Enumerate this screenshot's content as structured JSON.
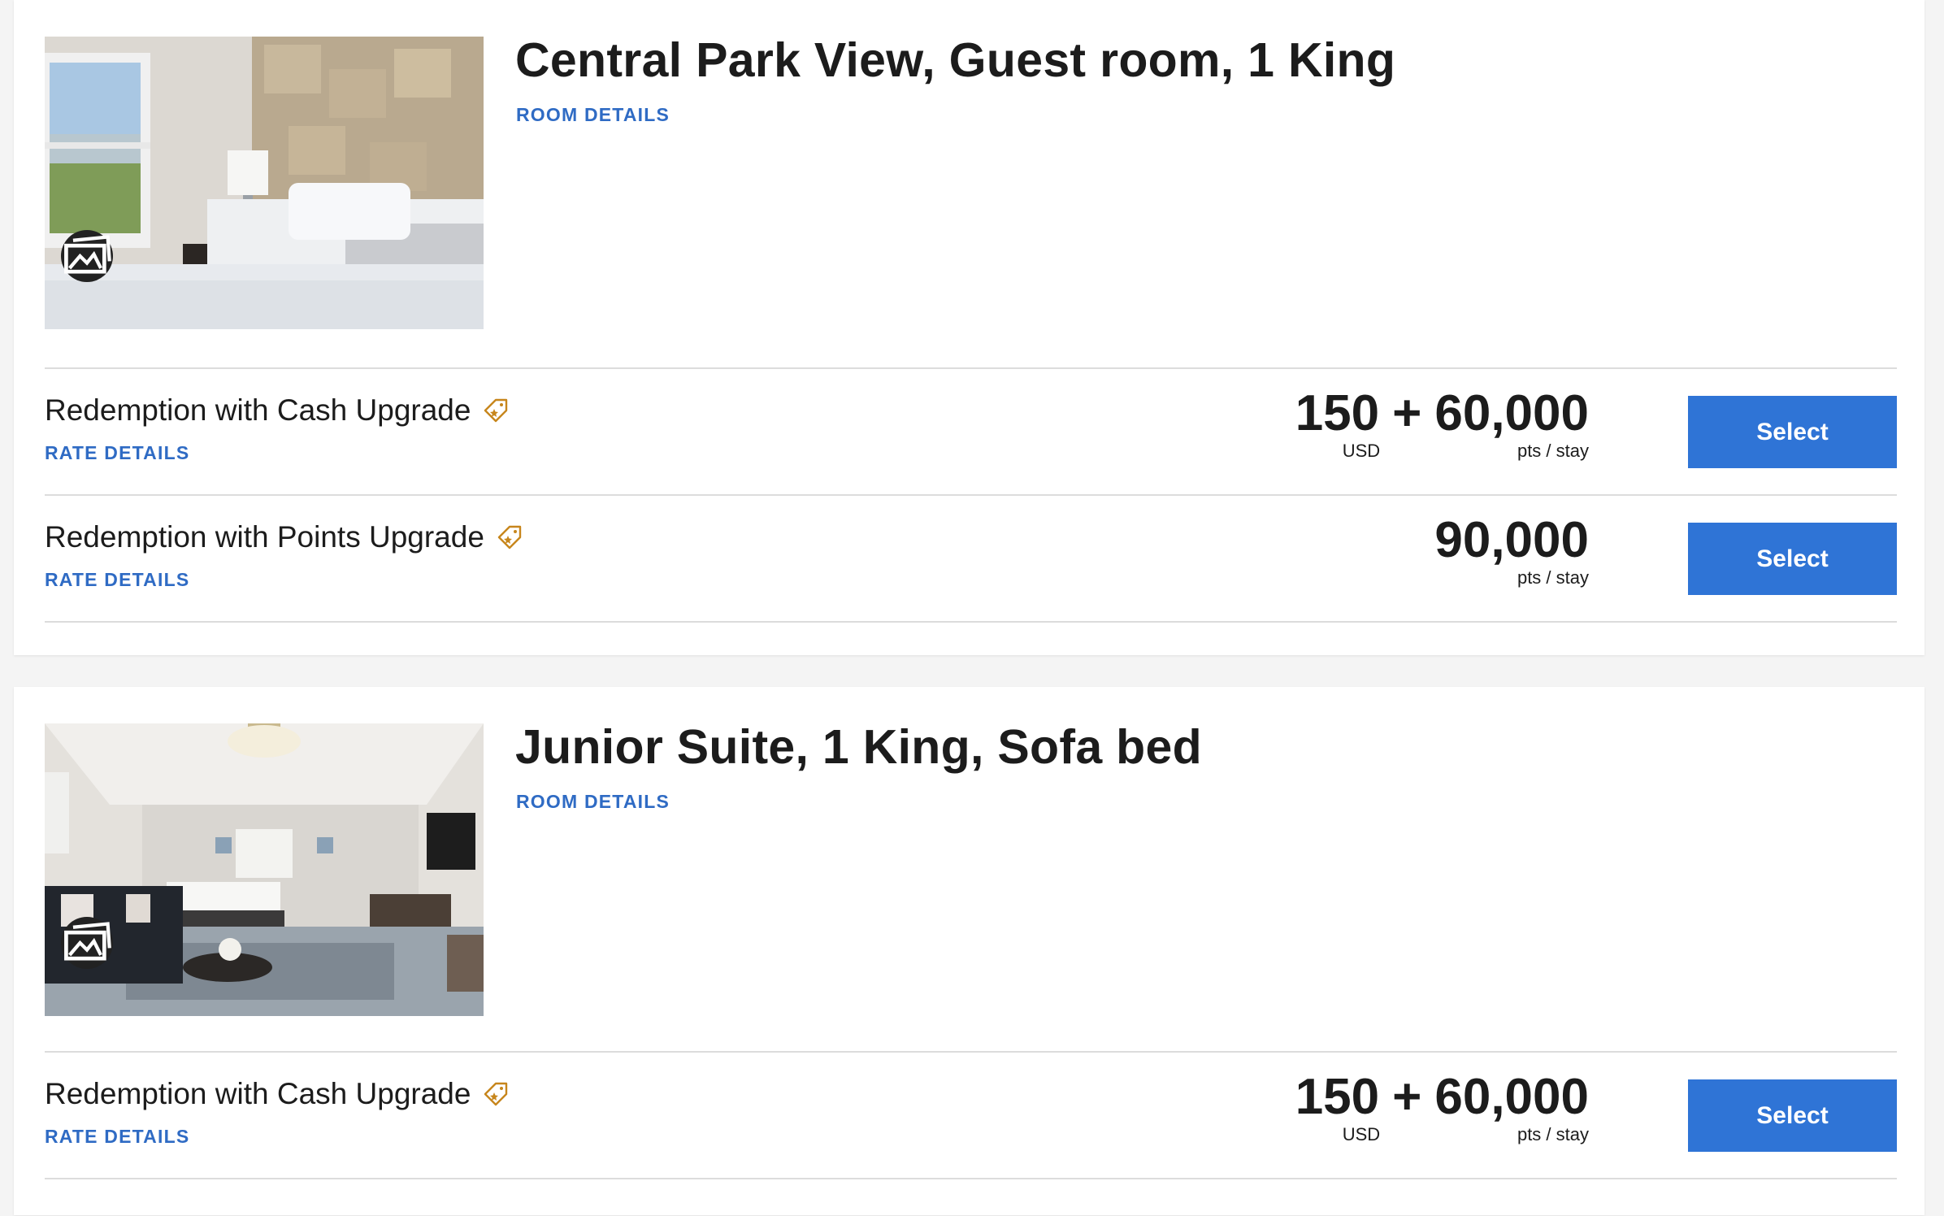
{
  "colors": {
    "link": "#2f6bc4",
    "button": "#2f74d6",
    "tag_icon": "#c7861c",
    "divider": "#dcdcdc"
  },
  "rooms": [
    {
      "title": "Central Park View, Guest room, 1 King",
      "details_link": "ROOM DETAILS",
      "gallery_icon": "photo-gallery-icon",
      "rates": [
        {
          "name": "Redemption with Cash Upgrade",
          "icon": "upgrade-tag-icon",
          "details_link": "RATE DETAILS",
          "cash": "150",
          "plus": "+",
          "points": "60,000",
          "cash_unit": "USD",
          "points_unit": "pts / stay",
          "button": "Select"
        },
        {
          "name": "Redemption with Points Upgrade",
          "icon": "upgrade-tag-icon",
          "details_link": "RATE DETAILS",
          "points": "90,000",
          "points_unit": "pts / stay",
          "button": "Select"
        }
      ]
    },
    {
      "title": "Junior Suite, 1 King, Sofa bed",
      "details_link": "ROOM DETAILS",
      "gallery_icon": "photo-gallery-icon",
      "rates": [
        {
          "name": "Redemption with Cash Upgrade",
          "icon": "upgrade-tag-icon",
          "details_link": "RATE DETAILS",
          "cash": "150",
          "plus": "+",
          "points": "60,000",
          "cash_unit": "USD",
          "points_unit": "pts / stay",
          "button": "Select"
        }
      ]
    }
  ]
}
